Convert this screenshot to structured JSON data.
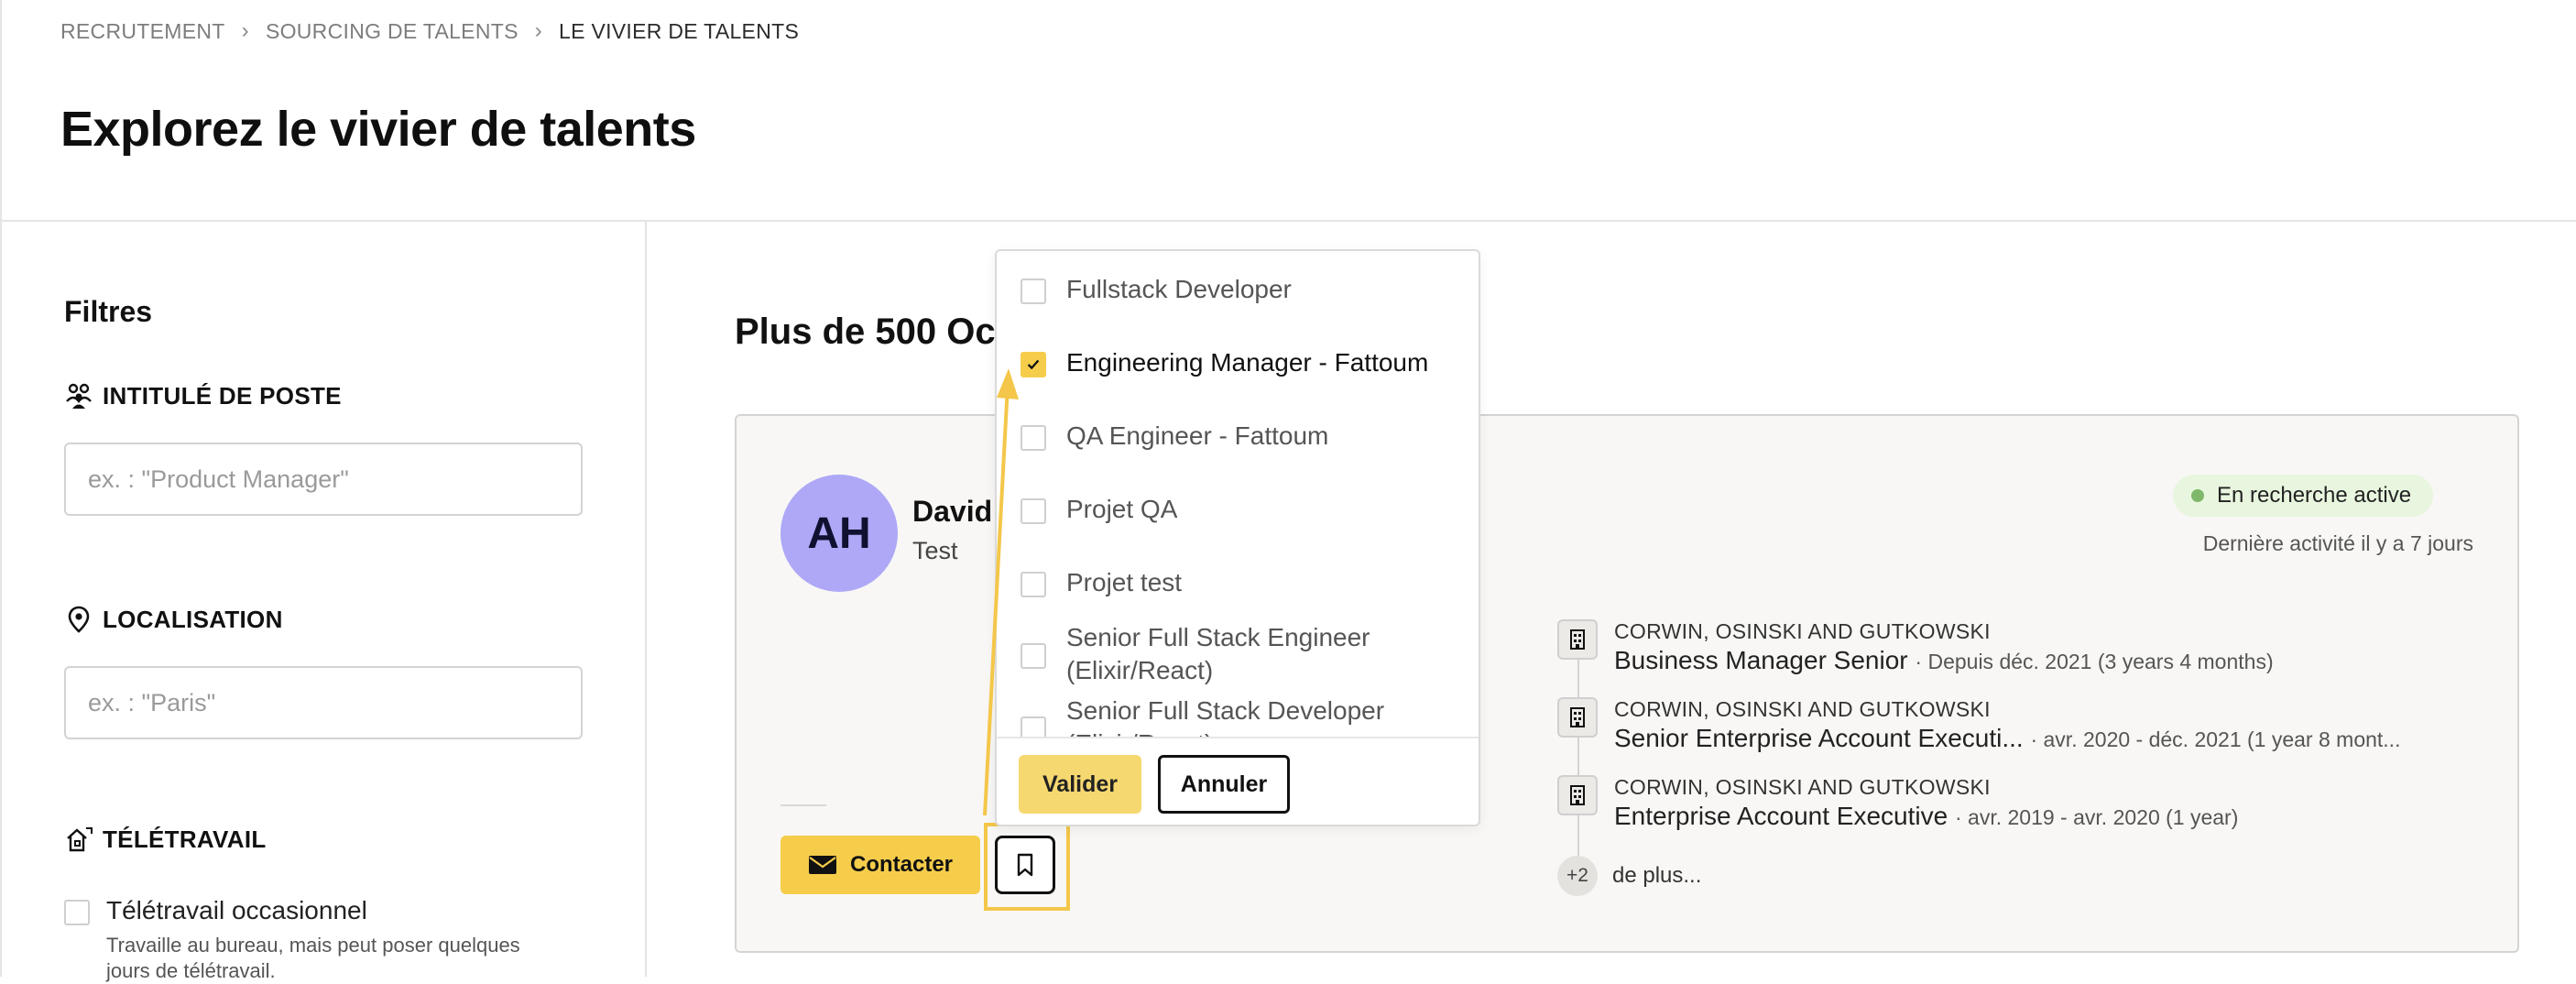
{
  "breadcrumb": [
    "RECRUTEMENT",
    "SOURCING DE TALENTS",
    "LE VIVIER DE TALENTS"
  ],
  "page_title": "Explorez le vivier de talents",
  "filters": {
    "title": "Filtres",
    "job_title": {
      "label": "INTITULÉ DE POSTE",
      "placeholder": "ex. : \"Product Manager\""
    },
    "location": {
      "label": "LOCALISATION",
      "placeholder": "ex. : \"Paris\""
    },
    "remote": {
      "label": "TÉLÉTRAVAIL",
      "option_title": "Télétravail occasionnel",
      "option_desc": "Travaille au bureau, mais peut poser quelques jours de télétravail."
    }
  },
  "results": {
    "count_label": "Plus de 500 Oc"
  },
  "candidate": {
    "initials": "AH",
    "name": "David",
    "subtitle": "Test",
    "status": "En recherche active",
    "last_activity": "Dernière activité il y a 7 jours",
    "contact_label": "Contacter",
    "experiences": [
      {
        "company": "CORWIN, OSINSKI AND GUTKOWSKI",
        "role": "Business Manager Senior",
        "period": "· Depuis déc. 2021 (3 years 4 months)"
      },
      {
        "company": "CORWIN, OSINSKI AND GUTKOWSKI",
        "role": "Senior Enterprise Account Executi...",
        "period": "· avr. 2020 - déc. 2021 (1 year 8 mont..."
      },
      {
        "company": "CORWIN, OSINSKI AND GUTKOWSKI",
        "role": "Enterprise Account Executive",
        "period": "· avr. 2019 - avr. 2020 (1 year)"
      }
    ],
    "more_count": "+2",
    "more_label": "de plus..."
  },
  "dropdown": {
    "items": [
      {
        "label": "Fullstack Developer",
        "checked": false
      },
      {
        "label": "Engineering Manager - Fattoum",
        "checked": true
      },
      {
        "label": "QA Engineer - Fattoum",
        "checked": false
      },
      {
        "label": "Projet QA",
        "checked": false
      },
      {
        "label": "Projet test",
        "checked": false
      },
      {
        "label": "Senior Full Stack Engineer (Elixir/React)",
        "checked": false
      },
      {
        "label": "Senior Full Stack Developer (Elixir/React)",
        "checked": false
      }
    ],
    "validate_label": "Valider",
    "cancel_label": "Annuler"
  },
  "colors": {
    "accent": "#f6cd4b",
    "avatar": "#aea8f7",
    "status_dot": "#7fb86a",
    "status_bg": "#e9f6df"
  }
}
